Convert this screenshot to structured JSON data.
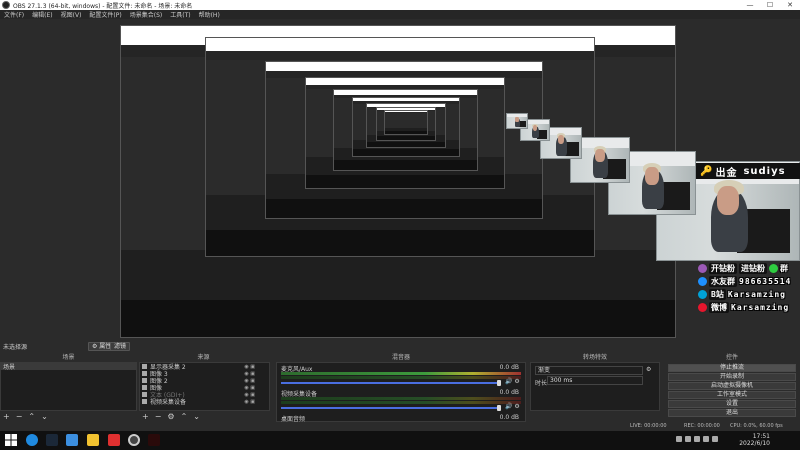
{
  "window": {
    "title": "OBS 27.1.3 (64-bit, windows) - 配置文件: 未命名 - 场景: 未命名",
    "minimize": "—",
    "maximize": "☐",
    "close": "✕"
  },
  "menu": [
    "文件(F)",
    "编辑(E)",
    "视图(V)",
    "配置文件(P)",
    "场景集合(S)",
    "工具(T)",
    "帮助(H)"
  ],
  "overlay": {
    "chujin_key": "🔑",
    "chujin": "出金",
    "sudiys": "sudiys",
    "socials": [
      {
        "label": "开钻粉",
        "value": "进钻粉",
        "extra": "群",
        "color": "#9b59b6"
      },
      {
        "label": "水友群",
        "value": "986635514",
        "color": "#1e90ff"
      },
      {
        "label": "B站",
        "value": "Karsamzing",
        "color": "#00a1d6"
      },
      {
        "label": "微博",
        "value": "Karsamzing",
        "color": "#e6162d"
      }
    ]
  },
  "dock": {
    "unselected_source": "未选择源",
    "properties_btn": "⚙ 属性",
    "filters_btn": "滤镜",
    "scenes_title": "场景",
    "sources_title": "来源",
    "mixer_title": "混音器",
    "transitions_title": "转场特效",
    "controls_title": "控件",
    "scenes": [
      "场景"
    ],
    "sources": [
      "显示器采集 2",
      "图像 3",
      "图像 2",
      "图像",
      "文本 (GDI+)",
      "视频采集设备"
    ],
    "mixer": [
      {
        "name": "麦克风/Aux",
        "db": "0.0 dB"
      },
      {
        "name": "视频采集设备",
        "db": "0.0 dB"
      },
      {
        "name": "桌面音频",
        "db": "0.0 dB"
      }
    ],
    "transition": "渐变",
    "duration_label": "时长",
    "duration": "300 ms",
    "controls": [
      "停止推流",
      "开始录制",
      "启动虚拟摄像机",
      "工作室模式",
      "设置",
      "退出"
    ],
    "add": "+",
    "remove": "−",
    "up": "⌃",
    "down": "⌄"
  },
  "status": {
    "live": "LIVE: 00:00:00",
    "rec": "REC: 00:00:00",
    "cpu": "CPU: 0.0%, 60.00 fps"
  },
  "taskbar": {
    "time": "17:51",
    "date": "2022/6/10"
  }
}
